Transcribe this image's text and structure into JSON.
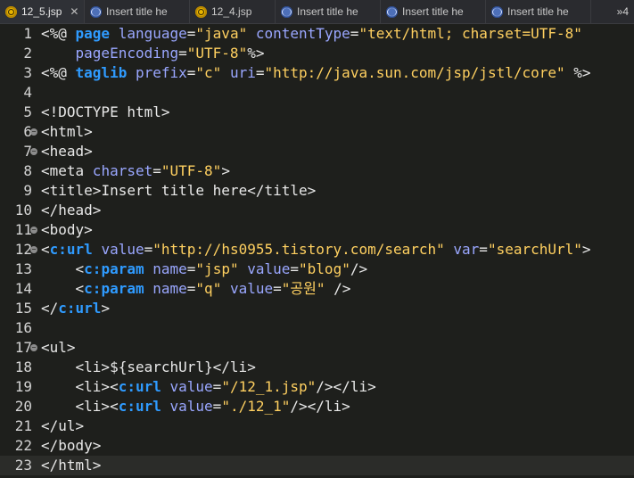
{
  "tabs": [
    {
      "label": "12_5.jsp",
      "icon": "jsp-file-icon",
      "active": true,
      "closable": true
    },
    {
      "label": "Insert title he",
      "icon": "web-page-icon",
      "active": false
    },
    {
      "label": "12_4.jsp",
      "icon": "jsp-file-icon",
      "active": false
    },
    {
      "label": "Insert title he",
      "icon": "web-page-icon",
      "active": false
    },
    {
      "label": "Insert title he",
      "icon": "web-page-icon",
      "active": false
    },
    {
      "label": "Insert title he",
      "icon": "web-page-icon",
      "active": false
    }
  ],
  "tab_overflow": {
    "label": "»4"
  },
  "editor": {
    "current_line": 23,
    "lines": [
      {
        "n": "1",
        "fold": false,
        "tokens": [
          [
            "t-dir",
            "<%@ "
          ],
          [
            "t-kw",
            "page"
          ],
          [
            "t-attr",
            " language"
          ],
          [
            "t-default",
            "="
          ],
          [
            "t-str",
            "\"java\""
          ],
          [
            "t-attr",
            " contentType"
          ],
          [
            "t-default",
            "="
          ],
          [
            "t-str",
            "\"text/html; charset=UTF-8\""
          ]
        ]
      },
      {
        "n": "2",
        "fold": false,
        "tokens": [
          [
            "t-attr",
            "    pageEncoding"
          ],
          [
            "t-default",
            "="
          ],
          [
            "t-str",
            "\"UTF-8\""
          ],
          [
            "t-dir",
            "%>"
          ]
        ]
      },
      {
        "n": "3",
        "fold": false,
        "tokens": [
          [
            "t-dir",
            "<%@ "
          ],
          [
            "t-kw",
            "taglib"
          ],
          [
            "t-attr",
            " prefix"
          ],
          [
            "t-default",
            "="
          ],
          [
            "t-str",
            "\"c\""
          ],
          [
            "t-attr",
            " uri"
          ],
          [
            "t-default",
            "="
          ],
          [
            "t-str",
            "\"http://java.sun.com/jsp/jstl/core\""
          ],
          [
            "t-dir",
            " %>"
          ]
        ]
      },
      {
        "n": "4",
        "fold": false,
        "tokens": []
      },
      {
        "n": "5",
        "fold": false,
        "tokens": [
          [
            "t-tag",
            "<!DOCTYPE html>"
          ]
        ]
      },
      {
        "n": "6",
        "fold": true,
        "tokens": [
          [
            "t-tag",
            "<html>"
          ]
        ]
      },
      {
        "n": "7",
        "fold": true,
        "tokens": [
          [
            "t-tag",
            "<head>"
          ]
        ]
      },
      {
        "n": "8",
        "fold": false,
        "tokens": [
          [
            "t-tag",
            "<meta"
          ],
          [
            "t-attr",
            " charset"
          ],
          [
            "t-default",
            "="
          ],
          [
            "t-str",
            "\"UTF-8\""
          ],
          [
            "t-tag",
            ">"
          ]
        ]
      },
      {
        "n": "9",
        "fold": false,
        "tokens": [
          [
            "t-tag",
            "<title>"
          ],
          [
            "t-text",
            "Insert title here"
          ],
          [
            "t-tag",
            "</title>"
          ]
        ]
      },
      {
        "n": "10",
        "fold": false,
        "tokens": [
          [
            "t-tag",
            "</head>"
          ]
        ]
      },
      {
        "n": "11",
        "fold": true,
        "tokens": [
          [
            "t-tag",
            "<body>"
          ]
        ]
      },
      {
        "n": "12",
        "fold": true,
        "tokens": [
          [
            "t-tag",
            "<"
          ],
          [
            "t-ctag",
            "c:url"
          ],
          [
            "t-attr",
            " value"
          ],
          [
            "t-default",
            "="
          ],
          [
            "t-str",
            "\"http://hs0955.tistory.com/search\""
          ],
          [
            "t-attr",
            " var"
          ],
          [
            "t-default",
            "="
          ],
          [
            "t-str",
            "\"searchUrl\""
          ],
          [
            "t-tag",
            ">"
          ]
        ]
      },
      {
        "n": "13",
        "fold": false,
        "tokens": [
          [
            "t-tag",
            "    <"
          ],
          [
            "t-ctag",
            "c:param"
          ],
          [
            "t-attr",
            " name"
          ],
          [
            "t-default",
            "="
          ],
          [
            "t-str",
            "\"jsp\""
          ],
          [
            "t-attr",
            " value"
          ],
          [
            "t-default",
            "="
          ],
          [
            "t-str",
            "\"blog\""
          ],
          [
            "t-tag",
            "/>"
          ]
        ]
      },
      {
        "n": "14",
        "fold": false,
        "tokens": [
          [
            "t-tag",
            "    <"
          ],
          [
            "t-ctag",
            "c:param"
          ],
          [
            "t-attr",
            " name"
          ],
          [
            "t-default",
            "="
          ],
          [
            "t-str",
            "\"q\""
          ],
          [
            "t-attr",
            " value"
          ],
          [
            "t-default",
            "="
          ],
          [
            "t-str",
            "\"공원\""
          ],
          [
            "t-tag",
            " />"
          ]
        ]
      },
      {
        "n": "15",
        "fold": false,
        "tokens": [
          [
            "t-tag",
            "</"
          ],
          [
            "t-ctag",
            "c:url"
          ],
          [
            "t-tag",
            ">"
          ]
        ]
      },
      {
        "n": "16",
        "fold": false,
        "tokens": []
      },
      {
        "n": "17",
        "fold": true,
        "tokens": [
          [
            "t-tag",
            "<ul>"
          ]
        ]
      },
      {
        "n": "18",
        "fold": false,
        "tokens": [
          [
            "t-tag",
            "    <li>"
          ],
          [
            "t-text",
            "${searchUrl}"
          ],
          [
            "t-tag",
            "</li>"
          ]
        ]
      },
      {
        "n": "19",
        "fold": false,
        "tokens": [
          [
            "t-tag",
            "    <li><"
          ],
          [
            "t-ctag",
            "c:url"
          ],
          [
            "t-attr",
            " value"
          ],
          [
            "t-default",
            "="
          ],
          [
            "t-str",
            "\"/12_1.jsp\""
          ],
          [
            "t-tag",
            "/></li>"
          ]
        ]
      },
      {
        "n": "20",
        "fold": false,
        "tokens": [
          [
            "t-tag",
            "    <li><"
          ],
          [
            "t-ctag",
            "c:url"
          ],
          [
            "t-attr",
            " value"
          ],
          [
            "t-default",
            "="
          ],
          [
            "t-str",
            "\"./12_1\""
          ],
          [
            "t-tag",
            "/></li>"
          ]
        ]
      },
      {
        "n": "21",
        "fold": false,
        "tokens": [
          [
            "t-tag",
            "</ul>"
          ]
        ]
      },
      {
        "n": "22",
        "fold": false,
        "tokens": [
          [
            "t-tag",
            "</body>"
          ]
        ]
      },
      {
        "n": "23",
        "fold": false,
        "tokens": [
          [
            "t-tag",
            "</html>"
          ]
        ]
      }
    ]
  }
}
